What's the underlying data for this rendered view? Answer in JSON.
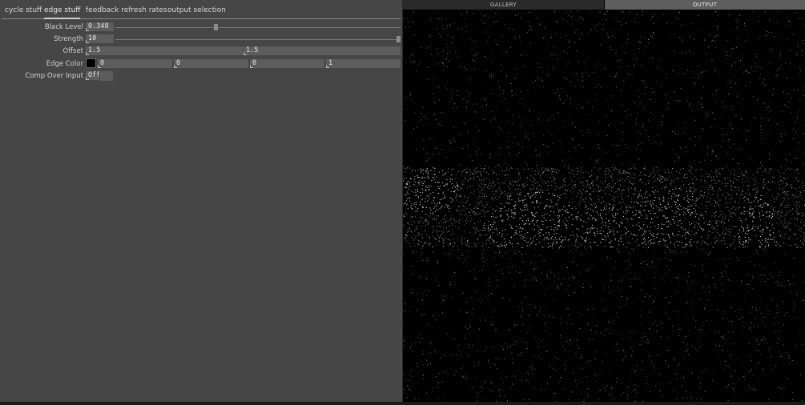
{
  "tabs": [
    "cycle stuff",
    "edge stuff",
    "feedback refresh rates",
    "output selection"
  ],
  "active_tab": "edge stuff",
  "params": {
    "black_level": {
      "label": "Black Level",
      "value": "0.348",
      "slider_fraction": 0.348
    },
    "strength": {
      "label": "Strength",
      "value": "10",
      "slider_fraction": 1.0
    },
    "offset": {
      "label": "Offset",
      "values": [
        "1.5",
        "1.5"
      ]
    },
    "edge_color": {
      "label": "Edge Color",
      "swatch": "#000000",
      "values": [
        "0",
        "0",
        "0",
        "1"
      ]
    },
    "comp_over_input": {
      "label": "Comp Over Input",
      "value": "Off"
    }
  },
  "viewer": {
    "tabs": [
      "GALLERY",
      "OUTPUT"
    ],
    "active": "OUTPUT"
  }
}
